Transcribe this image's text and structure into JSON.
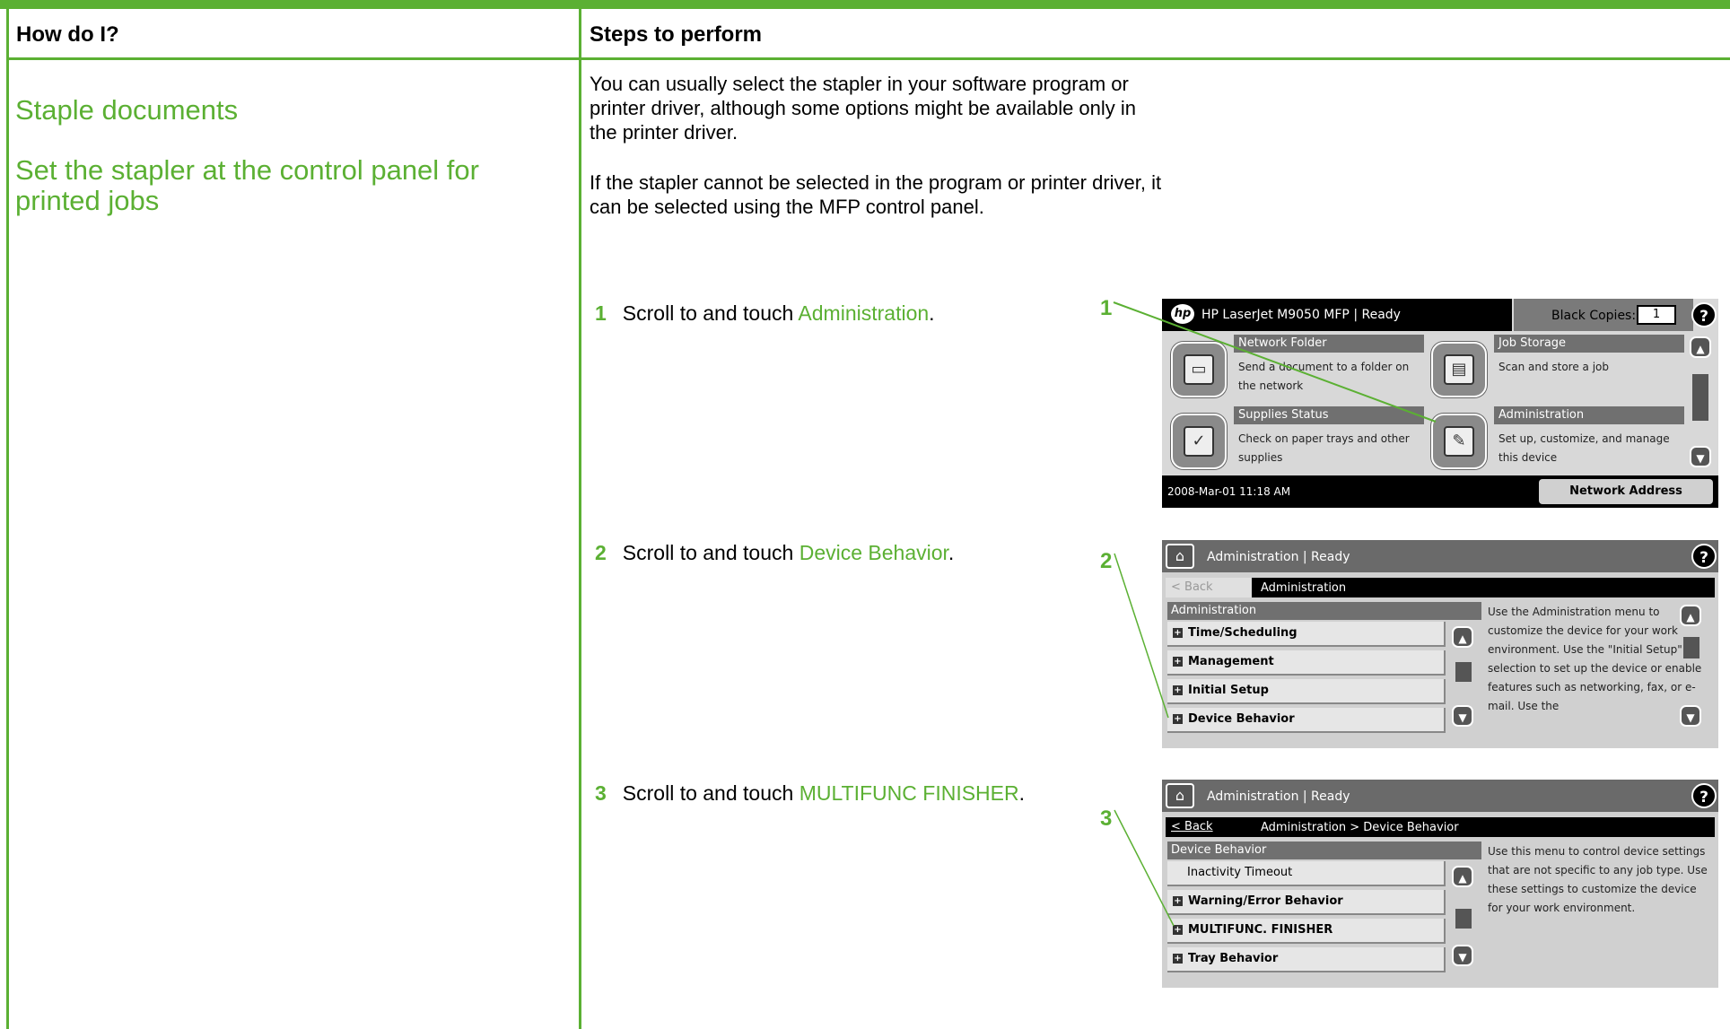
{
  "header": {
    "col1": "How do I?",
    "col2": "Steps to perform"
  },
  "left": {
    "title1": "Staple documents",
    "title2": "Set the stapler at the control panel for printed jobs"
  },
  "intro": {
    "p1": "You can usually select the stapler in your software program or printer driver, although some options might be available only in the printer driver.",
    "p2": "If the stapler cannot be selected in the program or printer driver, it can be selected using the MFP control panel."
  },
  "steps": [
    {
      "num": "1",
      "text": "Scroll to and touch ",
      "kw": "Administration",
      "end": "."
    },
    {
      "num": "2",
      "text": "Scroll to and touch ",
      "kw": "Device Behavior",
      "end": "."
    },
    {
      "num": "3",
      "text": "Scroll to and touch ",
      "kw": "MULTIFUNC FINISHER",
      "end": "."
    }
  ],
  "callouts": [
    "1",
    "2",
    "3"
  ],
  "screen1": {
    "logo": "hp",
    "title": "HP LaserJet M9050 MFP | Ready",
    "copies_label": "Black Copies:",
    "copies_value": "1",
    "help": "?",
    "tiles": [
      {
        "title": "Network Folder",
        "desc": "Send a document to a folder on the network"
      },
      {
        "title": "Job Storage",
        "desc": "Scan and store a job"
      },
      {
        "title": "Supplies Status",
        "desc": "Check on paper trays and other supplies"
      },
      {
        "title": "Administration",
        "desc": "Set up, customize, and manage this device"
      }
    ],
    "date": "2008-Mar-01 11:18 AM",
    "network_button": "Network Address"
  },
  "screen2": {
    "title": "Administration | Ready",
    "back": "< Back",
    "path": "Administration",
    "list_header": "Administration",
    "items": [
      "Time/Scheduling",
      "Management",
      "Initial Setup",
      "Device Behavior"
    ],
    "desc": "Use the Administration menu to customize the device for your work environment. Use the \"Initial Setup\" selection to set up the device or enable features such as networking, fax, or e-mail. Use the"
  },
  "screen3": {
    "title": "Administration | Ready",
    "back": "< Back",
    "path": "Administration > Device Behavior",
    "list_header": "Device Behavior",
    "items": [
      "Inactivity Timeout",
      "Warning/Error Behavior",
      "MULTIFUNC. FINISHER",
      "Tray Behavior"
    ],
    "desc": "Use this menu to control device settings that are not specific to any job type. Use these settings to customize the device for your work environment."
  },
  "colors": {
    "accent": "#5bb033"
  }
}
